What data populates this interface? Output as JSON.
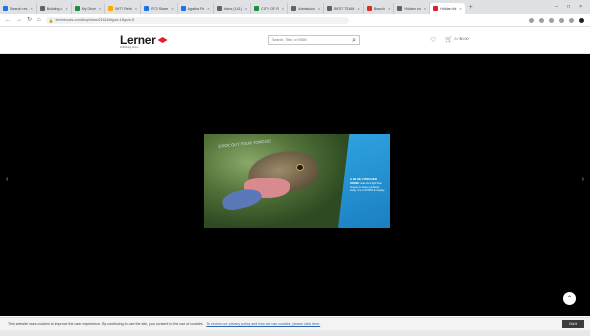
{
  "browser": {
    "tabs": [
      {
        "label": "Search res",
        "color": "#1a73e8",
        "active": false
      },
      {
        "label": "Building c",
        "color": "#5f6368",
        "active": false
      },
      {
        "label": "My Drive",
        "color": "#1e8e3e",
        "active": false
      },
      {
        "label": "IM77 Retri",
        "color": "#f9ab00",
        "active": false
      },
      {
        "label": "R72 Share",
        "color": "#1a73e8",
        "active": false
      },
      {
        "label": "Agatha Fri",
        "color": "#1a73e8",
        "active": false
      },
      {
        "label": "Inbox (141)",
        "color": "#5f6368",
        "active": false
      },
      {
        "label": "CITY OF R",
        "color": "#1e8e3e",
        "active": false
      },
      {
        "label": "Admission",
        "color": "#5f6368",
        "active": false
      },
      {
        "label": "BEST TEAM",
        "color": "#5f6368",
        "active": false
      },
      {
        "label": "Branch",
        "color": "#d93025",
        "active": false
      },
      {
        "label": "Hidden on",
        "color": "#5f6368",
        "active": false
      },
      {
        "label": "Hidden thi",
        "color": "#e31d2b",
        "active": true
      }
    ],
    "url": "lernerbooks.com/shop/show/21614#figure-1/figure-8"
  },
  "site": {
    "logo_text": "Lerner",
    "logo_sub": "Publishing Group",
    "search_placeholder": "Search, Title, or ISBN",
    "cart_text": "0 / $0.00"
  },
  "poster": {
    "headline": "STICK OUT YOUR TONGUE!",
    "panel_title": "A BLUE-TONGUED SKINK",
    "panel_body": "uses its bright blue tongue to scare predators away. It is a STARTLE display."
  },
  "cookie": {
    "text": "This website uses cookies to improve the user experience. By continuing to use the site, you consent to the use of cookies.",
    "link": "To review our privacy policy and how we use cookies, please click here.",
    "button": "Got it"
  },
  "colors": {
    "brand_red": "#e31d2b",
    "panel_blue": "#2fa3e0"
  }
}
